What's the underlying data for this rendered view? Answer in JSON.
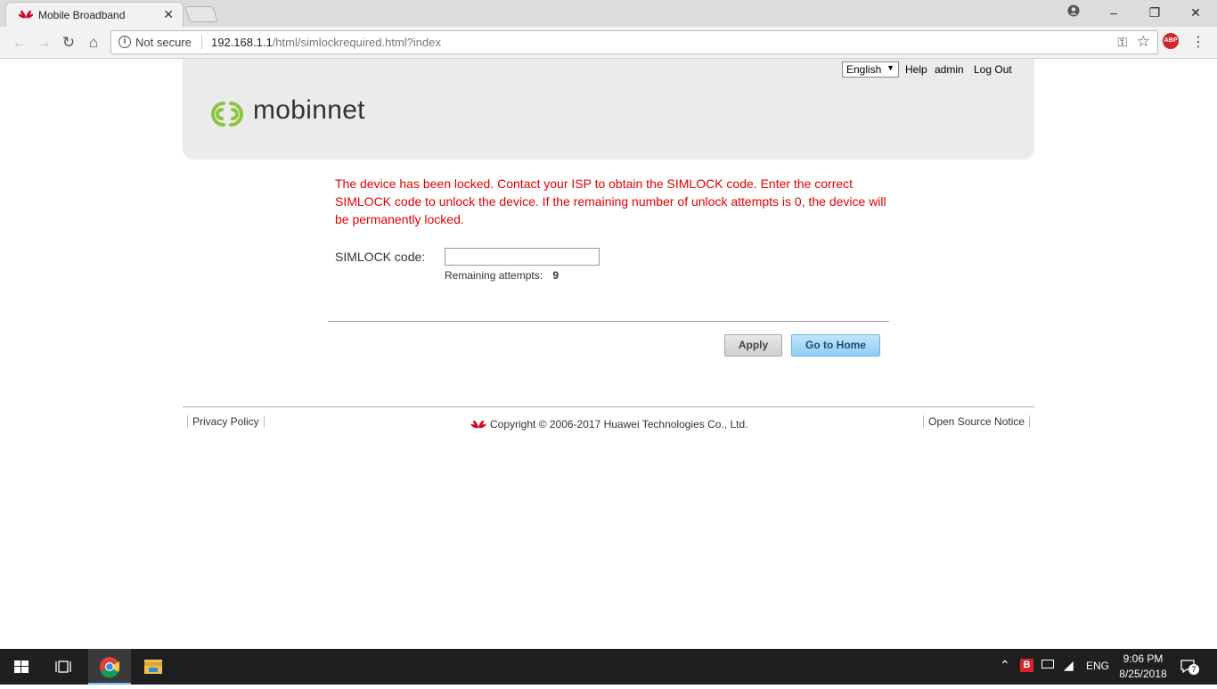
{
  "browser": {
    "tab_title": "Mobile Broadband",
    "tab_close": "✕",
    "security_label": "Not secure",
    "url_host": "192.168.1.1",
    "url_path": "/html/simlockrequired.html?index",
    "abp_label": "ABP"
  },
  "header": {
    "language": "English",
    "help": "Help",
    "user": "admin",
    "logout": "Log Out",
    "brand": "mobinnet"
  },
  "main": {
    "warning": "The device has been locked. Contact your ISP to obtain the SIMLOCK code. Enter the correct SIMLOCK code to unlock the device. If the remaining number of unlock attempts is 0, the device will be permanently locked.",
    "simlock_label": "SIMLOCK code:",
    "simlock_value": "",
    "remaining_label": "Remaining attempts:",
    "remaining_value": "9",
    "apply_button": "Apply",
    "home_button": "Go to Home"
  },
  "footer": {
    "privacy": "Privacy Policy",
    "copyright": "Copyright © 2006-2017 Huawei Technologies Co., Ltd.",
    "open_source": "Open Source Notice"
  },
  "taskbar": {
    "language": "ENG",
    "time": "9:06 PM",
    "date": "8/25/2018",
    "notifications": "7"
  },
  "colors": {
    "warning": "#e00000",
    "brand_green": "#8cc63f",
    "huawei_red": "#cf0a2c"
  }
}
